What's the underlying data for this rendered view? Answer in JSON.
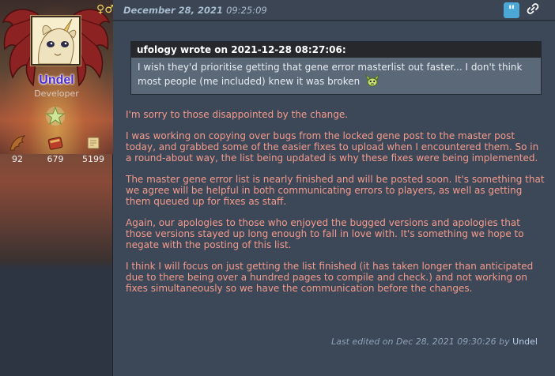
{
  "sidebar": {
    "username": "Undel",
    "role": "Developer",
    "gender_icon": "♀♂",
    "stats": [
      {
        "icon": "wing-icon",
        "value": "92"
      },
      {
        "icon": "book-icon",
        "value": "679"
      },
      {
        "icon": "scroll-icon",
        "value": "5199"
      }
    ]
  },
  "post": {
    "date": "December 28, 2021",
    "time": "09:25:09",
    "quote": {
      "header": "ufology wrote on 2021-12-28 08:27:06:",
      "text": "I wish they'd prioritise getting that gene error masterlist out faster... I don't think most people (me included) knew it was broken"
    },
    "paragraphs": [
      "I'm sorry to those disappointed by the change.",
      "I was working on copying over bugs from the locked gene post to the master post today, and grabbed some of the easier fixes to upload when I encountered them. So in a round-about way, the list being updated is why these fixes were being implemented.",
      "The master gene error list is nearly finished and will be posted soon. It's something that we agree will be helpful in both communicating errors to players, as well as getting them queued up for fixes as staff.",
      "Again, our apologies to those who enjoyed the bugged versions and apologies that those versions stayed up long enough to fall in love with. It's something we hope to negate with the posting of this list.",
      "I think I will focus on just getting the list finished (it has taken longer than anticipated due to there being over a hundred pages to compile and check.) and not working on fixes simultaneously so we have the communication before the changes."
    ],
    "edit_prefix": "Last edited on Dec 28, 2021 09:30:26 by",
    "edit_user": "Undel"
  },
  "colors": {
    "background": "#2c3440",
    "post_background": "#3c4757",
    "message_text": "#f59b8c",
    "username": "#4f2bd2",
    "quote_button": "#4aa7d6"
  }
}
